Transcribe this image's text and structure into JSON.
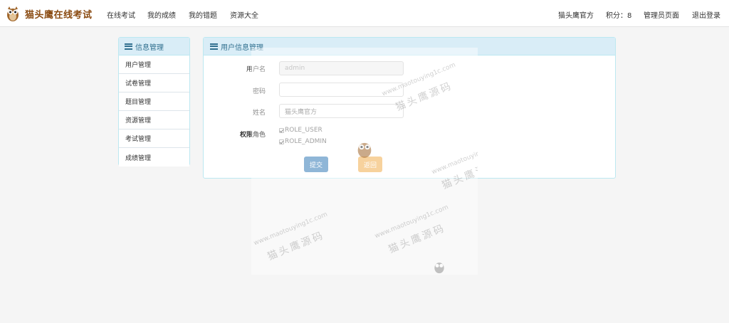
{
  "brand": {
    "name": "猫头鹰在线考试"
  },
  "nav": {
    "left": [
      "在线考试",
      "我的成绩",
      "我的错题",
      "资源大全"
    ],
    "user": "猫头鹰官方",
    "points": "积分：8",
    "admin": "管理员页面",
    "logout": "退出登录"
  },
  "sidebar": {
    "title": "信息管理",
    "items": [
      "用户管理",
      "试卷管理",
      "题目管理",
      "资源管理",
      "考试管理",
      "成绩管理"
    ]
  },
  "main": {
    "title": "用户信息管理",
    "labels": {
      "username": "用户名",
      "password": "密码",
      "name": "姓名",
      "roles": "权限角色"
    },
    "values": {
      "username": "admin",
      "password": "",
      "name": "猫头鹰官方"
    },
    "roles": [
      "ROLE_USER",
      "ROLE_ADMIN"
    ],
    "submit": "提交",
    "back": "返回"
  },
  "watermark": {
    "url": "www.maotouying1c.com",
    "cn": "猫头鹰源码"
  },
  "colors": {
    "brand": "#8a4b12",
    "panel_header": "#d9edf7",
    "primary": "#337ab7",
    "warning": "#f0ad4e"
  }
}
